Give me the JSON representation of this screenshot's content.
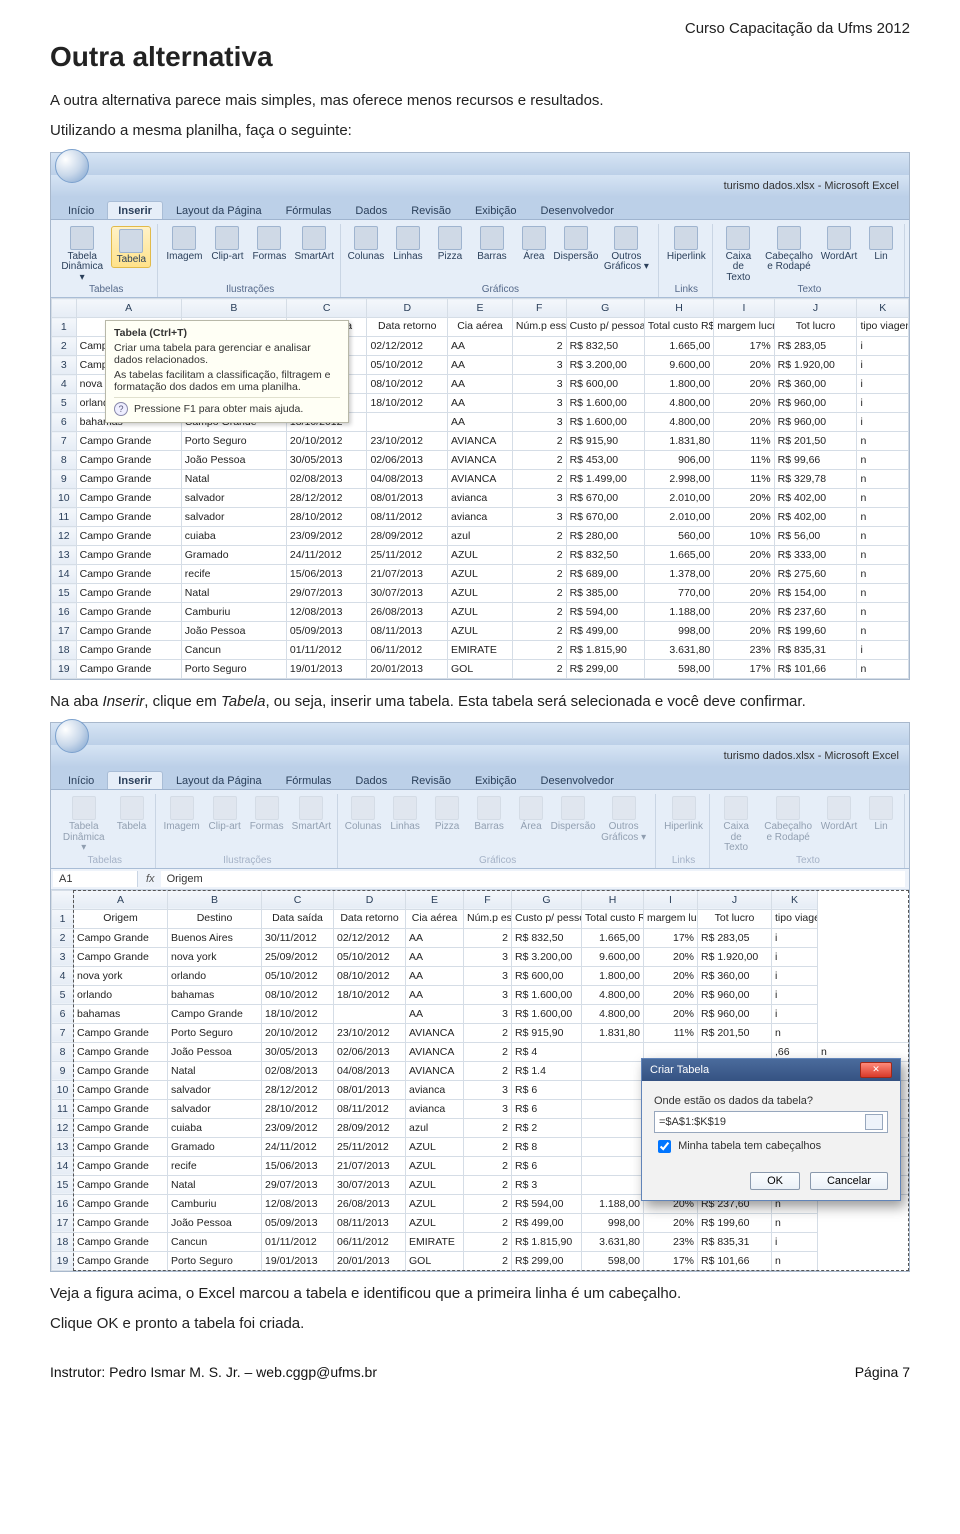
{
  "course_tag": "Curso Capacitação da Ufms 2012",
  "h1": "Outra alternativa",
  "p1": "A outra alternativa parece mais simples, mas oferece menos recursos e resultados.",
  "p2": "Utilizando a mesma planilha, faça o seguinte:",
  "p3_pre": "Na aba ",
  "p3_i1": "Inserir",
  "p3_mid": ", clique em ",
  "p3_i2": "Tabela",
  "p3_post": ", ou seja, inserir uma tabela. Esta tabela será selecionada e você deve confirmar.",
  "p4": "Veja a figura acima, o Excel marcou a tabela e identificou que a primeira linha é um cabeçalho.",
  "p5": "Clique OK e pronto a tabela foi criada.",
  "footer_left": "Instrutor: Pedro Ismar M. S. Jr. – web.cggp@ufms.br",
  "footer_right": "Página 7",
  "excel": {
    "titlebar": "turismo dados.xlsx - Microsoft Excel",
    "tabs": [
      "Início",
      "Inserir",
      "Layout da Página",
      "Fórmulas",
      "Dados",
      "Revisão",
      "Exibição",
      "Desenvolvedor"
    ],
    "active_tab": "Inserir",
    "groups": [
      {
        "label": "Tabelas",
        "items": [
          "Tabela Dinâmica ▾",
          "Tabela"
        ]
      },
      {
        "label": "Ilustrações",
        "items": [
          "Imagem",
          "Clip-art",
          "Formas",
          "SmartArt"
        ]
      },
      {
        "label": "Gráficos",
        "items": [
          "Colunas",
          "Linhas",
          "Pizza",
          "Barras",
          "Área",
          "Dispersão",
          "Outros Gráficos ▾"
        ]
      },
      {
        "label": "Links",
        "items": [
          "Hiperlink"
        ]
      },
      {
        "label": "Texto",
        "items": [
          "Caixa de Texto",
          "Cabeçalho e Rodapé",
          "WordArt",
          "Lin"
        ]
      }
    ],
    "tooltip": {
      "title": "Tabela (Ctrl+T)",
      "body1": "Criar uma tabela para gerenciar e analisar dados relacionados.",
      "body2": "As tabelas facilitam a classificação, filtragem e formatação dos dados em uma planilha.",
      "help": "Pressione F1 para obter mais ajuda."
    },
    "namebox": "A1",
    "formula_text": "Origem",
    "col_letters": [
      "A",
      "B",
      "C",
      "D",
      "E",
      "F",
      "G",
      "H",
      "I",
      "J",
      "K"
    ],
    "headers": [
      "Origem",
      "Destino",
      "Data saída",
      "Data retorno",
      "Cia aérea",
      "Núm.p essoas",
      "Custo p/ pessoa",
      "Total custo R$",
      "margem lucro pp",
      "Tot lucro",
      "tipo viagem"
    ],
    "rows": [
      [
        "Campo Grande",
        "Buenos Aires",
        "30/11/2012",
        "02/12/2012",
        "AA",
        "2",
        "R$   832,50",
        "1.665,00",
        "17%",
        "R$   283,05",
        "i"
      ],
      [
        "Campo Grande",
        "nova york",
        "25/09/2012",
        "05/10/2012",
        "AA",
        "3",
        "R$ 3.200,00",
        "9.600,00",
        "20%",
        "R$ 1.920,00",
        "i"
      ],
      [
        "nova york",
        "orlando",
        "05/10/2012",
        "08/10/2012",
        "AA",
        "3",
        "R$   600,00",
        "1.800,00",
        "20%",
        "R$   360,00",
        "i"
      ],
      [
        "orlando",
        "bahamas",
        "08/10/2012",
        "18/10/2012",
        "AA",
        "3",
        "R$ 1.600,00",
        "4.800,00",
        "20%",
        "R$   960,00",
        "i"
      ],
      [
        "bahamas",
        "Campo Grande",
        "18/10/2012",
        "",
        "AA",
        "3",
        "R$ 1.600,00",
        "4.800,00",
        "20%",
        "R$   960,00",
        "i"
      ],
      [
        "Campo Grande",
        "Porto Seguro",
        "20/10/2012",
        "23/10/2012",
        "AVIANCA",
        "2",
        "R$   915,90",
        "1.831,80",
        "11%",
        "R$   201,50",
        "n"
      ],
      [
        "Campo Grande",
        "João Pessoa",
        "30/05/2013",
        "02/06/2013",
        "AVIANCA",
        "2",
        "R$   453,00",
        "906,00",
        "11%",
        "R$     99,66",
        "n"
      ],
      [
        "Campo Grande",
        "Natal",
        "02/08/2013",
        "04/08/2013",
        "AVIANCA",
        "2",
        "R$ 1.499,00",
        "2.998,00",
        "11%",
        "R$   329,78",
        "n"
      ],
      [
        "Campo Grande",
        "salvador",
        "28/12/2012",
        "08/01/2013",
        "avianca",
        "3",
        "R$   670,00",
        "2.010,00",
        "20%",
        "R$   402,00",
        "n"
      ],
      [
        "Campo Grande",
        "salvador",
        "28/10/2012",
        "08/11/2012",
        "avianca",
        "3",
        "R$   670,00",
        "2.010,00",
        "20%",
        "R$   402,00",
        "n"
      ],
      [
        "Campo Grande",
        "cuiaba",
        "23/09/2012",
        "28/09/2012",
        "azul",
        "2",
        "R$   280,00",
        "560,00",
        "10%",
        "R$     56,00",
        "n"
      ],
      [
        "Campo Grande",
        "Gramado",
        "24/11/2012",
        "25/11/2012",
        "AZUL",
        "2",
        "R$   832,50",
        "1.665,00",
        "20%",
        "R$   333,00",
        "n"
      ],
      [
        "Campo Grande",
        "recife",
        "15/06/2013",
        "21/07/2013",
        "AZUL",
        "2",
        "R$   689,00",
        "1.378,00",
        "20%",
        "R$   275,60",
        "n"
      ],
      [
        "Campo Grande",
        "Natal",
        "29/07/2013",
        "30/07/2013",
        "AZUL",
        "2",
        "R$   385,00",
        "770,00",
        "20%",
        "R$   154,00",
        "n"
      ],
      [
        "Campo Grande",
        "Camburiu",
        "12/08/2013",
        "26/08/2013",
        "AZUL",
        "2",
        "R$   594,00",
        "1.188,00",
        "20%",
        "R$   237,60",
        "n"
      ],
      [
        "Campo Grande",
        "João Pessoa",
        "05/09/2013",
        "08/11/2013",
        "AZUL",
        "2",
        "R$   499,00",
        "998,00",
        "20%",
        "R$   199,60",
        "n"
      ],
      [
        "Campo Grande",
        "Cancun",
        "01/11/2012",
        "06/11/2012",
        "EMIRATE",
        "2",
        "R$ 1.815,90",
        "3.631,80",
        "23%",
        "R$   835,31",
        "i"
      ],
      [
        "Campo Grande",
        "Porto Seguro",
        "19/01/2013",
        "20/01/2013",
        "GOL",
        "2",
        "R$   299,00",
        "598,00",
        "17%",
        "R$   101,66",
        "n"
      ]
    ],
    "rows2_partial": [
      [
        "Campo Grande",
        "Buenos Aires",
        "30/11/2012",
        "02/12/2012",
        "AA",
        "2",
        "R$   832,50",
        "1.665,00",
        "17%",
        "R$   283,05",
        "i"
      ],
      [
        "Campo Grande",
        "nova york",
        "25/09/2012",
        "05/10/2012",
        "AA",
        "3",
        "R$ 3.200,00",
        "9.600,00",
        "20%",
        "R$ 1.920,00",
        "i"
      ],
      [
        "nova york",
        "orlando",
        "05/10/2012",
        "08/10/2012",
        "AA",
        "3",
        "R$   600,00",
        "1.800,00",
        "20%",
        "R$   360,00",
        "i"
      ],
      [
        "orlando",
        "bahamas",
        "08/10/2012",
        "18/10/2012",
        "AA",
        "3",
        "R$ 1.600,00",
        "4.800,00",
        "20%",
        "R$   960,00",
        "i"
      ],
      [
        "bahamas",
        "Campo Grande",
        "18/10/2012",
        "",
        "AA",
        "3",
        "R$ 1.600,00",
        "4.800,00",
        "20%",
        "R$   960,00",
        "i"
      ],
      [
        "Campo Grande",
        "Porto Seguro",
        "20/10/2012",
        "23/10/2012",
        "AVIANCA",
        "2",
        "R$   915,90",
        "1.831,80",
        "11%",
        "R$   201,50",
        "n"
      ],
      [
        "Campo Grande",
        "João Pessoa",
        "30/05/2013",
        "02/06/2013",
        "AVIANCA",
        "2",
        "R$   4",
        "",
        "",
        "",
        ",66",
        "n"
      ],
      [
        "Campo Grande",
        "Natal",
        "02/08/2013",
        "04/08/2013",
        "AVIANCA",
        "2",
        "R$ 1.4",
        "",
        "",
        "",
        ",78",
        "n"
      ],
      [
        "Campo Grande",
        "salvador",
        "28/12/2012",
        "08/01/2013",
        "avianca",
        "3",
        "R$   6",
        "",
        "",
        "",
        "2,00",
        "n"
      ],
      [
        "Campo Grande",
        "salvador",
        "28/10/2012",
        "08/11/2012",
        "avianca",
        "3",
        "R$   6",
        "",
        "",
        "",
        "2,00",
        "n"
      ],
      [
        "Campo Grande",
        "cuiaba",
        "23/09/2012",
        "28/09/2012",
        "azul",
        "2",
        "R$   2",
        "",
        "",
        "",
        "6,00",
        "n"
      ],
      [
        "Campo Grande",
        "Gramado",
        "24/11/2012",
        "25/11/2012",
        "AZUL",
        "2",
        "R$   8",
        "",
        "",
        "",
        "3,00",
        "n"
      ],
      [
        "Campo Grande",
        "recife",
        "15/06/2013",
        "21/07/2013",
        "AZUL",
        "2",
        "R$   6",
        "",
        "",
        "",
        "5,60",
        "n"
      ],
      [
        "Campo Grande",
        "Natal",
        "29/07/2013",
        "30/07/2013",
        "AZUL",
        "2",
        "R$   3",
        "",
        "",
        "",
        "4,00",
        "n"
      ],
      [
        "Campo Grande",
        "Camburiu",
        "12/08/2013",
        "26/08/2013",
        "AZUL",
        "2",
        "R$   594,00",
        "1.188,00",
        "20%",
        "R$   237,60",
        "n"
      ],
      [
        "Campo Grande",
        "João Pessoa",
        "05/09/2013",
        "08/11/2013",
        "AZUL",
        "2",
        "R$   499,00",
        "998,00",
        "20%",
        "R$   199,60",
        "n"
      ],
      [
        "Campo Grande",
        "Cancun",
        "01/11/2012",
        "06/11/2012",
        "EMIRATE",
        "2",
        "R$ 1.815,90",
        "3.631,80",
        "23%",
        "R$   835,31",
        "i"
      ],
      [
        "Campo Grande",
        "Porto Seguro",
        "19/01/2013",
        "20/01/2013",
        "GOL",
        "2",
        "R$   299,00",
        "598,00",
        "17%",
        "R$   101,66",
        "n"
      ]
    ]
  },
  "dialog": {
    "title": "Criar Tabela",
    "q": "Onde estão os dados da tabela?",
    "range": "=$A$1:$K$19",
    "chk": "Minha tabela tem cabeçalhos",
    "ok": "OK",
    "cancel": "Cancelar"
  }
}
